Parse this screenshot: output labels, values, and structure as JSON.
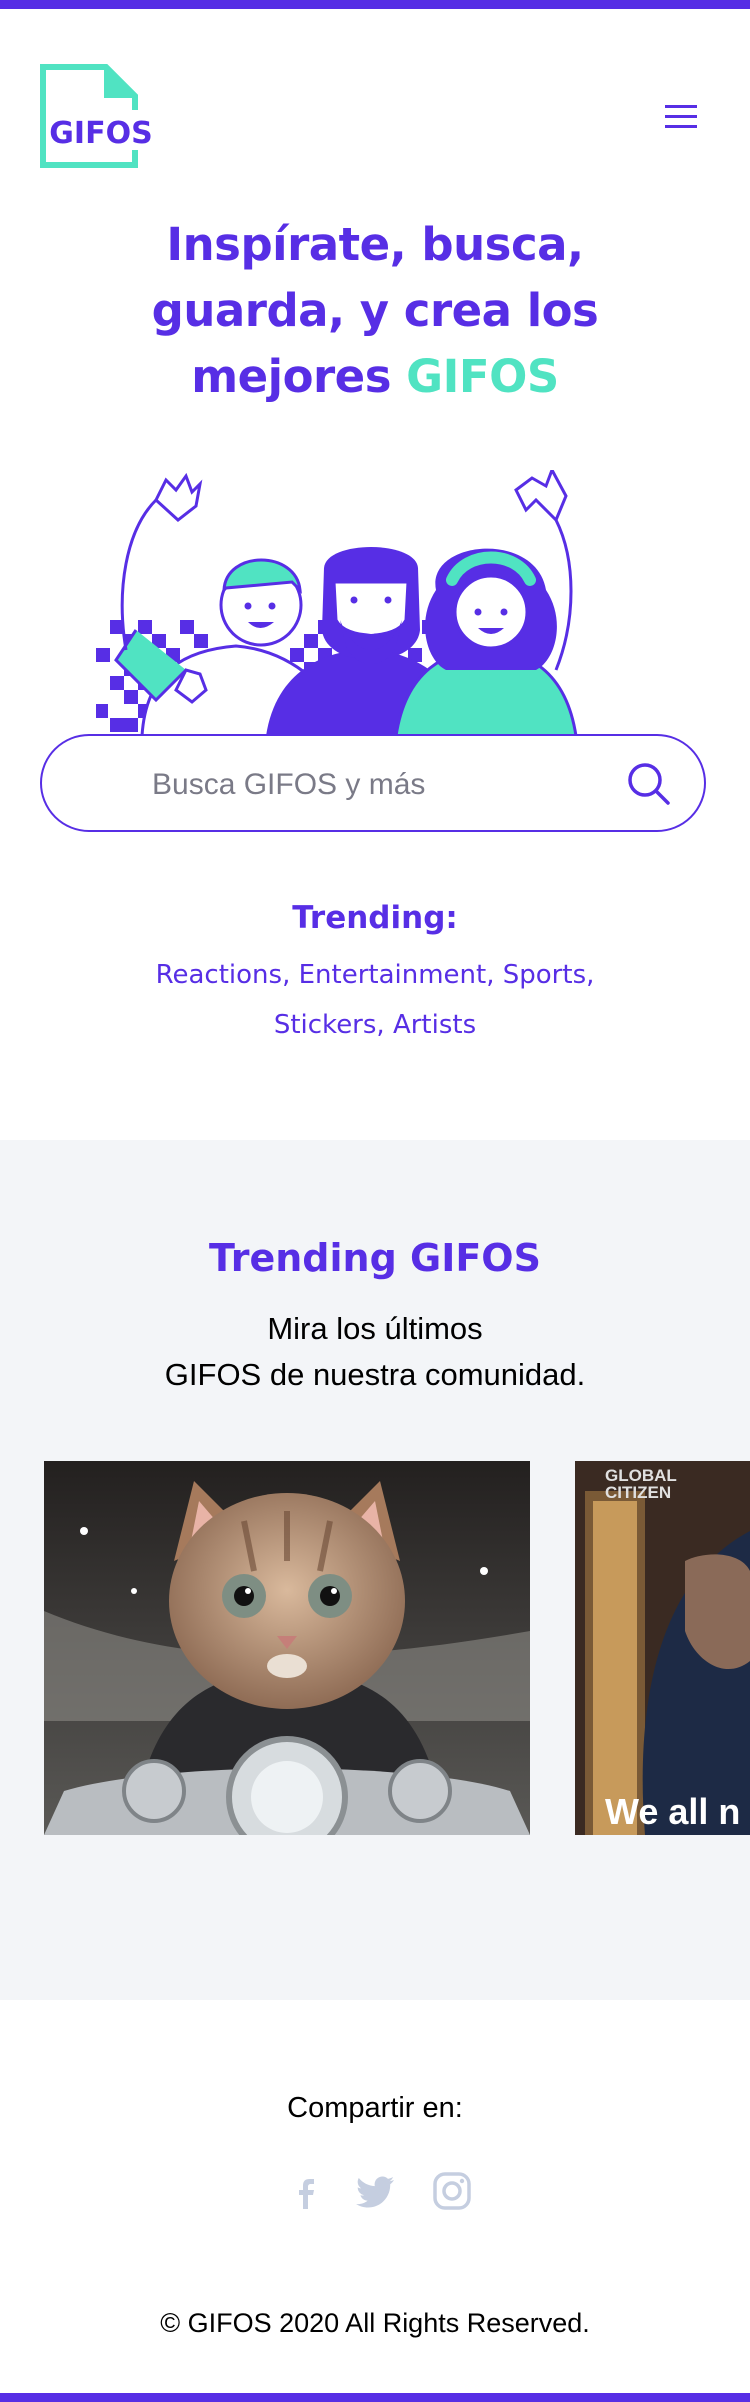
{
  "logo": {
    "text": "GIFOS"
  },
  "hero": {
    "line1": "Inspírate, busca,",
    "line2": "guarda, y crea los",
    "line3_prefix": "mejores ",
    "line3_accent": "GIFOS"
  },
  "search": {
    "placeholder": "Busca GIFOS y más"
  },
  "trending": {
    "label": "Trending:",
    "items": [
      "Reactions",
      "Entertainment",
      "Sports",
      "Stickers",
      "Artists"
    ],
    "sep": ", "
  },
  "trending_gifos": {
    "title": "Trending GIFOS",
    "subtitle_line1": "Mira los últimos",
    "subtitle_line2": "GIFOS de nuestra comunidad.",
    "gif2_logo_line1": "GLOBAL",
    "gif2_logo_line2": "CITIZEN",
    "gif2_caption": "We all n"
  },
  "footer": {
    "share_label": "Compartir en:",
    "copyright": "© GIFOS 2020 All Rights Reserved."
  },
  "colors": {
    "primary": "#572EE5",
    "accent": "#50E3C2",
    "section_bg": "#F3F5F8",
    "social_icon": "#C5CEE0"
  },
  "icons": [
    "menu-icon",
    "search-icon",
    "facebook-icon",
    "twitter-icon",
    "instagram-icon"
  ]
}
